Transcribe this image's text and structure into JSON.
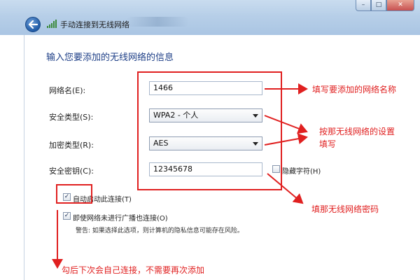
{
  "window": {
    "title": "手动连接到无线网络",
    "controls": {
      "minimize": "–",
      "maximize": "□",
      "close": "✕"
    }
  },
  "form": {
    "heading": "输入您要添加的无线网络的信息",
    "network_name": {
      "label": "网络名(E):",
      "value": "1466"
    },
    "security_type": {
      "label": "安全类型(S):",
      "value": "WPA2 - 个人"
    },
    "encryption_type": {
      "label": "加密类型(R):",
      "value": "AES"
    },
    "security_key": {
      "label": "安全密钥(C):",
      "value": "12345678"
    },
    "hide_chars": {
      "label": "隐藏字符(H)",
      "checked": false
    },
    "auto_connect": {
      "label": "自动启动此连接(T)",
      "checked": true
    },
    "connect_hidden": {
      "label": "即使网络未进行广播也连接(O)",
      "checked": true
    },
    "warning": "警告: 如果选择此选项，则计算机的隐私信息可能存在风险。"
  },
  "annotations": {
    "name_note": "填写要添加的网络名称",
    "security_note_line1": "按那无线网络的设置",
    "security_note_line2": "填写",
    "key_note": "填那无线网络密码",
    "auto_note": "勾后下次会自己连接，不需要再次添加"
  },
  "colors": {
    "annotation_red": "#e02020",
    "heading_blue": "#1e3f87",
    "titlebar_blue": "#b7cfe8"
  },
  "icons": {
    "back": "back-arrow-icon",
    "network": "wifi-signal-icon",
    "dropdown": "chevron-down-icon"
  }
}
